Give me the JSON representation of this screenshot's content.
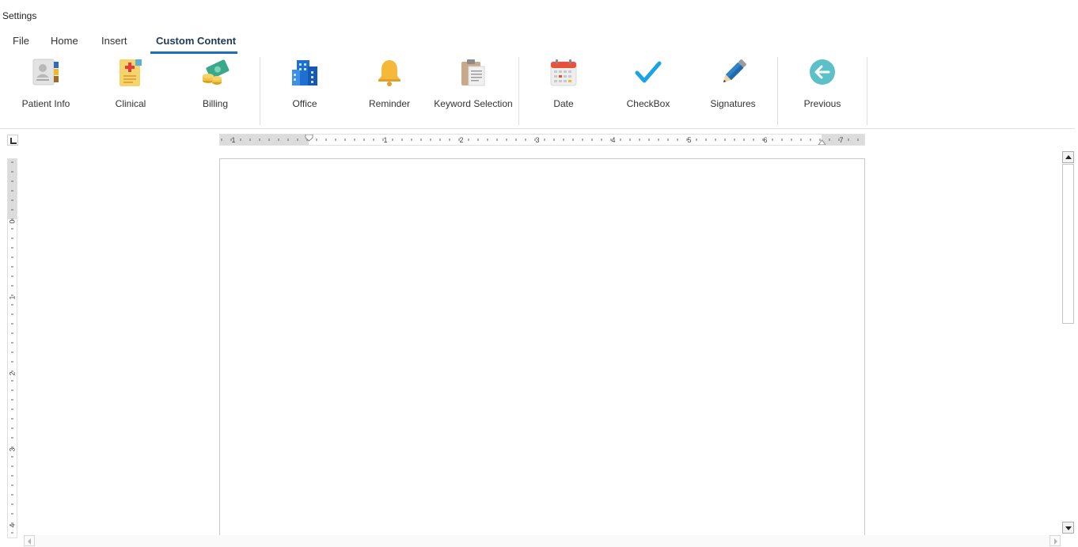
{
  "window": {
    "title": "Settings"
  },
  "tabs": [
    {
      "label": "File"
    },
    {
      "label": "Home"
    },
    {
      "label": "Insert"
    },
    {
      "label": "Custom Content",
      "active": true
    }
  ],
  "ribbon": {
    "items": [
      {
        "label": "Patient Info",
        "icon": "patient-card-icon"
      },
      {
        "label": "Clinical",
        "icon": "clinical-report-icon"
      },
      {
        "label": "Billing",
        "icon": "billing-money-icon"
      },
      {
        "label": "Office",
        "icon": "office-building-icon"
      },
      {
        "label": "Reminder",
        "icon": "bell-icon"
      },
      {
        "label": "Keyword Selection",
        "icon": "clipboard-icon"
      },
      {
        "label": "Date",
        "icon": "calendar-icon"
      },
      {
        "label": "CheckBox",
        "icon": "checkmark-icon"
      },
      {
        "label": "Signatures",
        "icon": "pencil-icon"
      },
      {
        "label": "Previous",
        "icon": "back-arrow-icon"
      }
    ]
  },
  "ruler": {
    "horizontal_numbers": [
      "1",
      "1",
      "2",
      "3",
      "4",
      "5",
      "6",
      "7"
    ],
    "vertical_numbers": [
      "0",
      "1",
      "2",
      "3",
      "4"
    ]
  },
  "colors": {
    "accent": "#1f6fb2",
    "checkmark": "#1aa3e8",
    "previous": "#5bc0c8",
    "bell": "#f5b93a"
  }
}
